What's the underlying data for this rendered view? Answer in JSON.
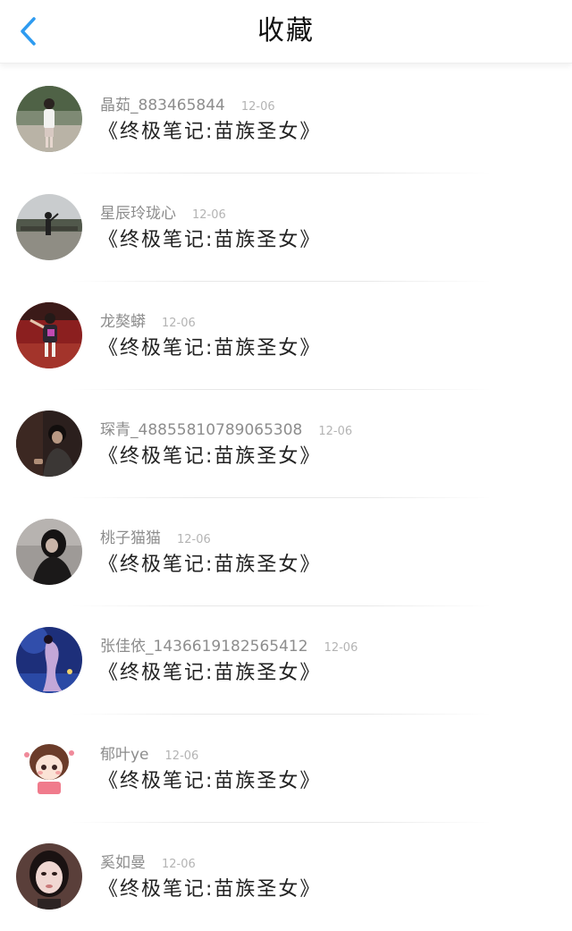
{
  "header": {
    "title": "收藏",
    "back_icon": "chevron-left-icon",
    "accent_color": "#2e9bf0"
  },
  "items": [
    {
      "username": "晶茹_883465844",
      "date": "12-06",
      "title": "《终极笔记:苗族圣女》"
    },
    {
      "username": "星辰玲珑心",
      "date": "12-06",
      "title": "《终极笔记:苗族圣女》"
    },
    {
      "username": "龙獒蟒",
      "date": "12-06",
      "title": "《终极笔记:苗族圣女》"
    },
    {
      "username": "琛青_488558107890653​08",
      "date": "12-06",
      "title": "《终极笔记:苗族圣女》"
    },
    {
      "username": "桃子猫猫",
      "date": "12-06",
      "title": "《终极笔记:苗族圣女》"
    },
    {
      "username": "张佳依_1436619182565412",
      "date": "12-06",
      "title": "《终极笔记:苗族圣女》"
    },
    {
      "username": "郁叶ye",
      "date": "12-06",
      "title": "《终极笔记:苗族圣女》"
    },
    {
      "username": "奚如曼",
      "date": "12-06",
      "title": "《终极笔记:苗族圣女》"
    }
  ]
}
